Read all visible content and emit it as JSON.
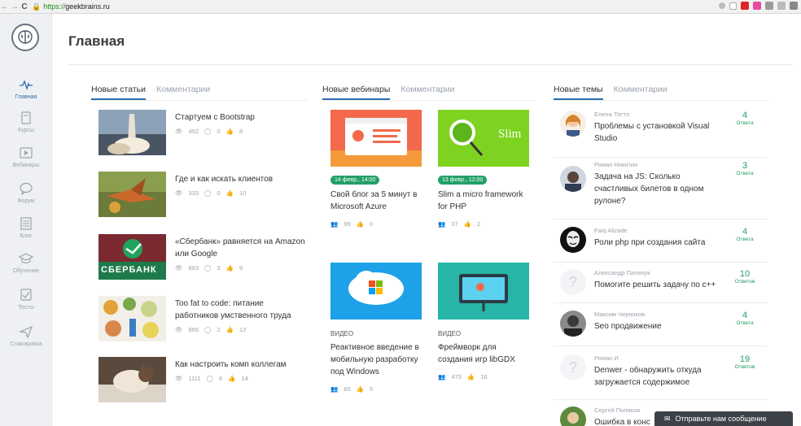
{
  "browser": {
    "url_proto": "https://",
    "url_rest": "geekbrains.ru"
  },
  "sidebar": {
    "items": [
      {
        "label": "Главная",
        "icon": "pulse-icon"
      },
      {
        "label": "Курсы",
        "icon": "book-icon"
      },
      {
        "label": "Вебинары",
        "icon": "play-icon"
      },
      {
        "label": "Форум",
        "icon": "chat-bubble-icon"
      },
      {
        "label": "Блог",
        "icon": "newspaper-icon"
      },
      {
        "label": "Обучение",
        "icon": "graduation-cap-icon"
      },
      {
        "label": "Тесты",
        "icon": "checkbox-icon"
      },
      {
        "label": "Стажировка",
        "icon": "paper-plane-icon"
      }
    ]
  },
  "page": {
    "title": "Главная"
  },
  "articles_col": {
    "tabs": [
      "Новые статьи",
      "Комментарии"
    ],
    "items": [
      {
        "title": "Стартуем с Bootstrap",
        "views": "452",
        "comments": "0",
        "likes": "8"
      },
      {
        "title": "Где и как искать клиентов",
        "views": "333",
        "comments": "0",
        "likes": "10"
      },
      {
        "title": "«Сбербанк» равняется на Amazon или Google",
        "views": "883",
        "comments": "3",
        "likes": "9",
        "image_text": "СБЕРБАНК"
      },
      {
        "title": "Too fat to code: питание работников умственного труда",
        "views": "866",
        "comments": "2",
        "likes": "12"
      },
      {
        "title": "Как настроить комп коллегам",
        "views": "1111",
        "comments": "6",
        "likes": "14"
      }
    ]
  },
  "webinars_col": {
    "tabs": [
      "Новые вебинары",
      "Комментарии"
    ],
    "items": [
      {
        "badge": "14 февр., 14:00",
        "title": "Свой блог за 5 минут в Microsoft Azure",
        "people": "99",
        "likes": "0"
      },
      {
        "badge": "13 февр., 12:00",
        "title": "Slim a micro framework for PHP",
        "people": "37",
        "likes": "2",
        "image_text": "Slim"
      },
      {
        "label": "ВИДЕО",
        "title": "Реактивное введение в мобильную разработку под Windows",
        "people": "85",
        "likes": "5"
      },
      {
        "label": "ВИДЕО",
        "title": "Фреймворк для создания игр libGDX",
        "people": "473",
        "likes": "16"
      }
    ]
  },
  "topics_col": {
    "tabs": [
      "Новые темы",
      "Комментарии"
    ],
    "items": [
      {
        "author": "Елена Тяттэ",
        "title": "Проблемы с установкой Visual Studio",
        "count": "4",
        "count_label": "Ответа"
      },
      {
        "author": "Роман Никитин",
        "title": "Задача на JS: Сколько счастливых билетов в одном рулоне?",
        "count": "3",
        "count_label": "Ответа"
      },
      {
        "author": "Faiq Alizade",
        "title": "Роли php при создания сайта",
        "count": "4",
        "count_label": "Ответа"
      },
      {
        "author": "Александр Палихук",
        "title": "Помогите решить задачу по с++",
        "count": "10",
        "count_label": "Ответов"
      },
      {
        "author": "Максим Черняков",
        "title": "Seo продвижение",
        "count": "4",
        "count_label": "Ответа"
      },
      {
        "author": "Роман И",
        "title": "Denwer - обнаружить откуда загружается содержимое",
        "count": "19",
        "count_label": "Ответов"
      },
      {
        "author": "Сергей Поляков",
        "title": "Ошибка в конс",
        "count": "",
        "count_label": ""
      }
    ]
  },
  "chat": {
    "label": "Отправьте нам сообщение"
  }
}
